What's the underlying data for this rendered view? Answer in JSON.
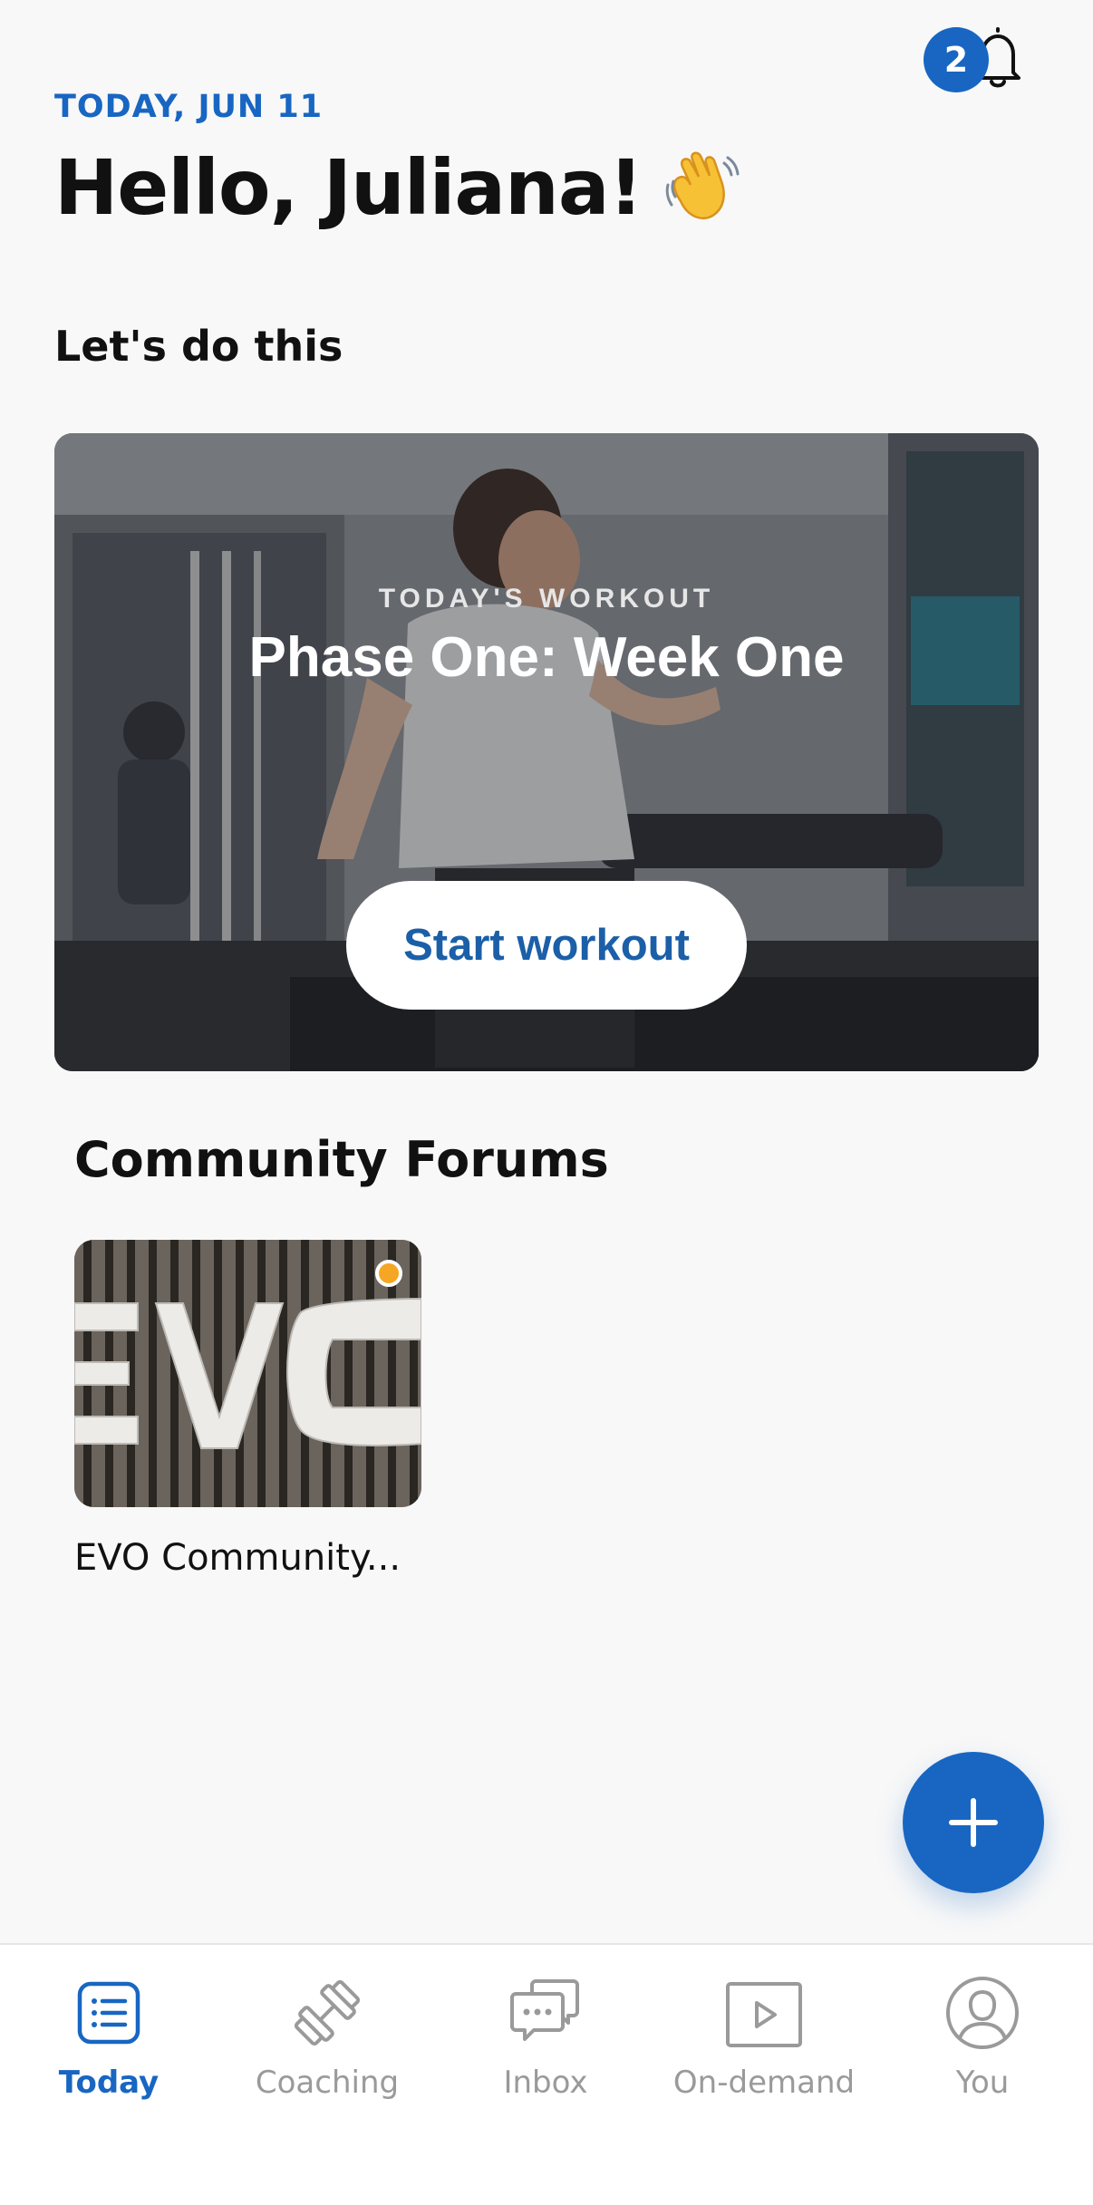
{
  "header": {
    "date": "TODAY, JUN 11",
    "greeting": "Hello, Juliana!",
    "greeting_emoji": "waving-hand-icon",
    "notification_count": "2"
  },
  "section": {
    "title": "Let's do this"
  },
  "workout": {
    "eyebrow": "TODAY'S WORKOUT",
    "title": "Phase One: Week One",
    "button_label": "Start workout"
  },
  "forums": {
    "title": "Community Forums",
    "items": [
      {
        "name": "EVO Community...",
        "unread": true
      }
    ]
  },
  "nav": {
    "items": [
      {
        "label": "Today",
        "icon": "checklist-icon",
        "active": true
      },
      {
        "label": "Coaching",
        "icon": "dumbbell-icon",
        "active": false
      },
      {
        "label": "Inbox",
        "icon": "chat-bubbles-icon",
        "active": false
      },
      {
        "label": "On-demand",
        "icon": "play-icon",
        "active": false
      },
      {
        "label": "You",
        "icon": "user-icon",
        "active": false
      }
    ]
  },
  "colors": {
    "accent": "#1866c2",
    "background": "#f8f8f8",
    "unread_dot": "#f5a623",
    "inactive_nav": "#9a9a9a"
  }
}
